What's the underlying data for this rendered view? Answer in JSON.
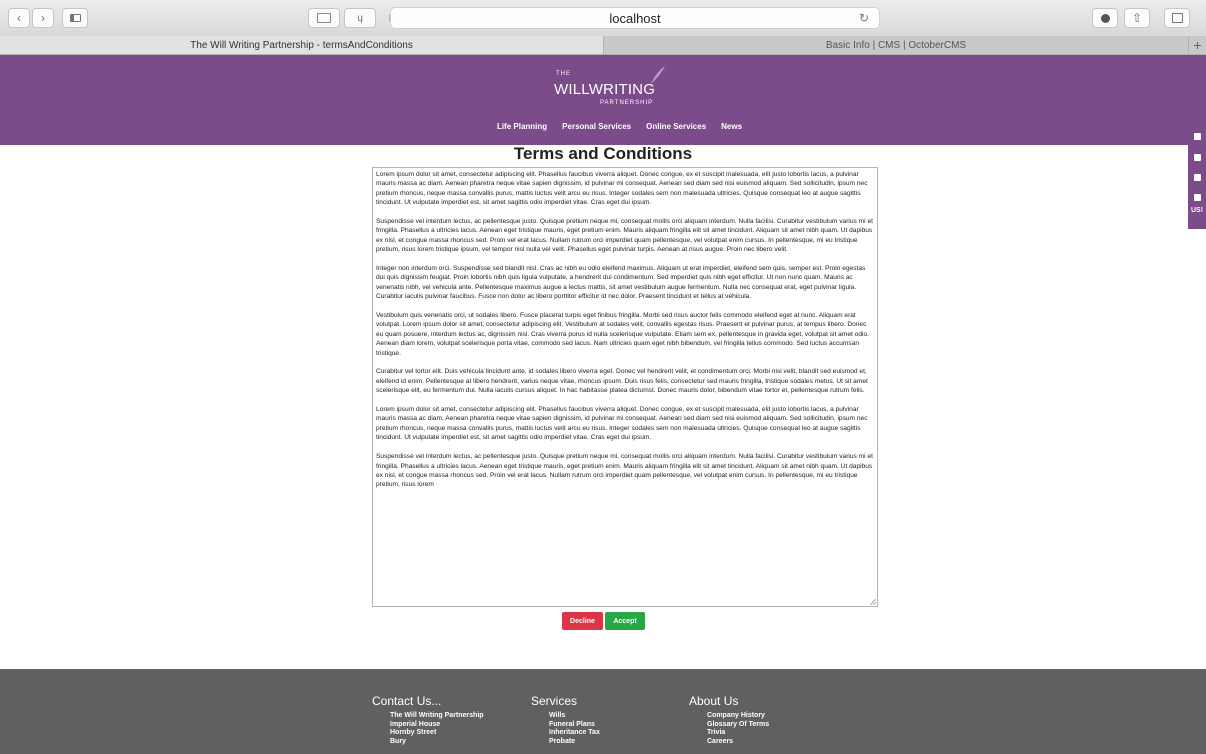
{
  "browser": {
    "address": "localhost",
    "tabs": [
      {
        "label": "The Will Writing Partnership - termsAndConditions",
        "active": true
      },
      {
        "label": "Basic Info | CMS | OctoberCMS",
        "active": false
      }
    ]
  },
  "site": {
    "logo": {
      "the": "THE",
      "main": "WILLWRITING",
      "partner": "PARTNERSHIP"
    },
    "nav": [
      "Life Planning",
      "Personal Services",
      "Online Services",
      "News"
    ],
    "social": {
      "us_label": "US!"
    }
  },
  "page": {
    "title": "Terms and Conditions",
    "paragraphs": [
      "Lorem ipsum dolor sit amet, consectetur adipiscing elit. Phasellus faucibus viverra aliquet. Donec congue, ex et suscipit malesuada, elit justo lobortis lacus, a pulvinar mauris massa ac diam. Aenean pharetra neque vitae sapien dignissim, id pulvinar mi consequat. Aenean sed diam sed nisi euismod aliquam. Sed sollicitudin, ipsum nec pretium rhoncus, neque massa convallis purus, mattis luctus velit arcu eu risus. Integer sodales sem non malesuada ultricies. Quisque consequat leo at augue sagittis tincidunt. Ut vulputate imperdiet est, sit amet sagittis odio imperdiet vitae. Cras eget dui ipsum.",
      "Suspendisse vel interdum lectus, ac pellentesque justo. Quisque pretium neque mi, consequat mollis orci aliquam interdum. Nulla facilisi. Curabitur vestibulum varius mi et fringilla. Phasellus a ultricies lacus. Aenean eget tristique mauris, eget pretium enim. Mauris aliquam fringilla elit sit amet tincidunt. Aliquam sit amet nibh quam. Ut dapibus ex nisl, et congue massa rhoncus sed. Proin vel erat lacus. Nullam rutrum orci imperdiet quam pellentesque, vel volutpat enim cursus. In pellentesque, mi eu tristique pretium, risus lorem tristique ipsum, vel tempor nisl nulla vel velit. Phasellus eget pulvinar turpis. Aenean at risus augue. Proin nec libero velit.",
      "Integer non interdum orci. Suspendisse sed blandit nisl. Cras ac nibh eu odio eleifend maximus. Aliquam ut erat imperdiet, eleifend sem quis, semper est. Proin egestas dui quis dignissim feugiat. Proin lobortis nibh quis ligula vulputate, a hendrerit dui condimentum. Sed imperdiet quis nibh eget efficitur. Ut non nunc quam. Mauris ac venenatis nibh, vel vehicula ante. Pellentesque maximus augue a lectus mattis, sit amet vestibulum augue fermentum. Nulla nec consequat erat, eget pulvinar ligula. Curabitur iaculis pulvinar faucibus. Fusce non dolor ac libero porttitor efficitur id nec dolor. Praesent tincidunt et tellus at vehicula.",
      "Vestibulum quis venenatis orci, ut sodales libero. Fusce placerat turpis eget finibus fringilla. Morbi sed risus auctor felis commodo eleifend eget at nunc. Aliquam erat volutpat. Lorem ipsum dolor sit amet, consectetur adipiscing elit. Vestibulum at sodales velit, convallis egestas risus. Praesent et pulvinar purus, at tempus libero. Donec eu quam posuere, interdum lectus ac, dignissim nisl. Cras viverra purus id nulla scelerisque vulputate. Etiam sem ex, pellentesque in gravida eget, volutpat sit amet odio. Aenean diam lorem, volutpat scelerisque porta vitae, commodo sed lacus. Nam ultricies quam eget nibh bibendum, vel fringilla tellus commodo. Sed luctus accumsan tristique.",
      "Curabitur vel tortor elit. Duis vehicula tincidunt ante, id sodales libero viverra eget. Donec vel hendrerit velit, et condimentum orci. Morbi nisi velit, blandit sed euismod et, eleifend id enim. Pellentesque at libero hendrerit, varius neque vitae, rhoncus ipsum. Duis risus felis, consectetur sed mauris fringilla, tristique sodales metus. Ut sit amet scelerisque elit, eu fermentum dui. Nulla iaculis cursus aliquet. In hac habitasse platea dictumst. Donec mauris dolor, bibendum vitae tortor et, pellentesque rutrum felis.",
      "Lorem ipsum dolor sit amet, consectetur adipiscing elit. Phasellus faucibus viverra aliquet. Donec congue, ex et suscipit malesuada, elit justo lobortis lacus, a pulvinar mauris massa ac diam. Aenean pharetra neque vitae sapien dignissim, id pulvinar mi consequat. Aenean sed diam sed nisi euismod aliquam. Sed sollicitudin, ipsum nec pretium rhoncus, neque massa convallis purus, mattis luctus velit arcu eu risus. Integer sodales sem non malesuada ultricies. Quisque consequat leo at augue sagittis tincidunt. Ut vulputate imperdiet est, sit amet sagittis odio imperdiet vitae. Cras eget dui ipsum.",
      "Suspendisse vel interdum lectus, ac pellentesque justo. Quisque pretium neque mi, consequat mollis orci aliquam interdum. Nulla facilisi. Curabitur vestibulum varius mi et fringilla. Phasellus a ultricies lacus. Aenean eget tristique mauris, eget pretium enim. Mauris aliquam fringilla elit sit amet tincidunt. Aliquam sit amet nibh quam. Ut dapibus ex nisl, et congue massa rhoncus sed. Proin vel erat lacus. Nullam rutrum orci imperdiet quam pellentesque, vel volutpat enim cursus. In pellentesque, mi eu tristique pretium, risus lorem"
    ],
    "decline_label": "Decline",
    "accept_label": "Accept"
  },
  "footer": {
    "contact": {
      "heading": "Contact Us...",
      "lines": [
        "The Will Writing Partnership",
        "Imperial House",
        "Hornby Street",
        "Bury"
      ]
    },
    "services": {
      "heading": "Services",
      "lines": [
        "Wills",
        "Funeral Plans",
        "Inheritance Tax",
        "Probate"
      ]
    },
    "about": {
      "heading": "About Us",
      "lines": [
        "Company History",
        "Glossary Of Terms",
        "Trivia",
        "Careers"
      ]
    }
  },
  "colors": {
    "brand_purple": "#7b4b8a",
    "footer_grey": "#5e6160",
    "decline_red": "#dc3545",
    "accept_green": "#28a745"
  }
}
